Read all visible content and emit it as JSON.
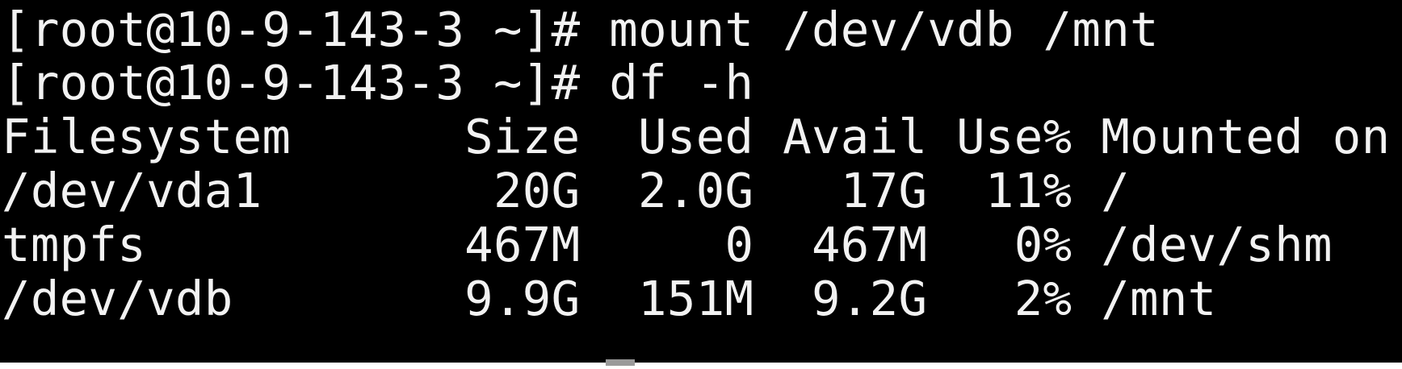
{
  "terminal": {
    "background_color": "#000000",
    "text_color": "#f2f2f2",
    "lines": [
      {
        "prompt": "[root@10-9-143-3 ~]#",
        "command": " mount /dev/vdb /mnt"
      },
      {
        "prompt": "[root@10-9-143-3 ~]#",
        "command": " df -h"
      }
    ],
    "df_output": {
      "header": "Filesystem      Size  Used Avail Use% Mounted on",
      "rows": [
        "/dev/vda1        20G  2.0G   17G  11% /",
        "tmpfs           467M     0  467M   0% /dev/shm",
        "/dev/vdb        9.9G  151M  9.2G   2% /mnt"
      ]
    }
  }
}
